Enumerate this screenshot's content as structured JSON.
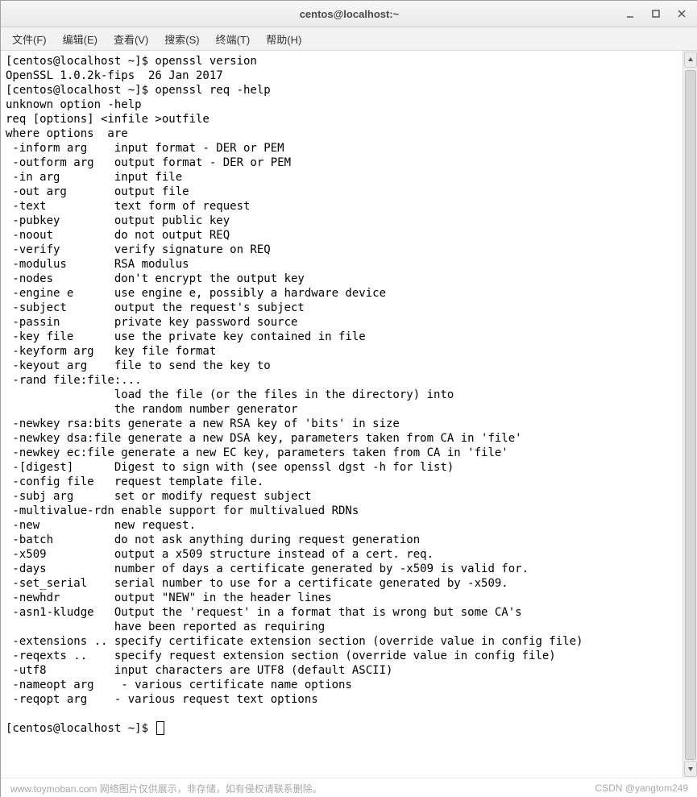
{
  "window": {
    "title": "centos@localhost:~"
  },
  "menu": {
    "items": [
      {
        "label": "文件(F)"
      },
      {
        "label": "编辑(E)"
      },
      {
        "label": "查看(V)"
      },
      {
        "label": "搜索(S)"
      },
      {
        "label": "终端(T)"
      },
      {
        "label": "帮助(H)"
      }
    ]
  },
  "terminal": {
    "prompt": "[centos@localhost ~]$ ",
    "cmd1": "openssl version",
    "out1": "OpenSSL 1.0.2k-fips  26 Jan 2017",
    "cmd2": "openssl req -help",
    "help_lines": [
      "unknown option -help",
      "req [options] <infile >outfile",
      "where options  are",
      " -inform arg    input format - DER or PEM",
      " -outform arg   output format - DER or PEM",
      " -in arg        input file",
      " -out arg       output file",
      " -text          text form of request",
      " -pubkey        output public key",
      " -noout         do not output REQ",
      " -verify        verify signature on REQ",
      " -modulus       RSA modulus",
      " -nodes         don't encrypt the output key",
      " -engine e      use engine e, possibly a hardware device",
      " -subject       output the request's subject",
      " -passin        private key password source",
      " -key file      use the private key contained in file",
      " -keyform arg   key file format",
      " -keyout arg    file to send the key to",
      " -rand file:file:...",
      "                load the file (or the files in the directory) into",
      "                the random number generator",
      " -newkey rsa:bits generate a new RSA key of 'bits' in size",
      " -newkey dsa:file generate a new DSA key, parameters taken from CA in 'file'",
      " -newkey ec:file generate a new EC key, parameters taken from CA in 'file'",
      " -[digest]      Digest to sign with (see openssl dgst -h for list)",
      " -config file   request template file.",
      " -subj arg      set or modify request subject",
      " -multivalue-rdn enable support for multivalued RDNs",
      " -new           new request.",
      " -batch         do not ask anything during request generation",
      " -x509          output a x509 structure instead of a cert. req.",
      " -days          number of days a certificate generated by -x509 is valid for.",
      " -set_serial    serial number to use for a certificate generated by -x509.",
      " -newhdr        output \"NEW\" in the header lines",
      " -asn1-kludge   Output the 'request' in a format that is wrong but some CA's",
      "                have been reported as requiring",
      " -extensions .. specify certificate extension section (override value in config file)",
      " -reqexts ..    specify request extension section (override value in config file)",
      " -utf8          input characters are UTF8 (default ASCII)",
      " -nameopt arg    - various certificate name options",
      " -reqopt arg    - various request text options",
      ""
    ]
  },
  "footer": {
    "left": "www.toymoban.com 网络图片仅供展示，非存储，如有侵权请联系删除。",
    "right": "CSDN @yangtom249"
  }
}
